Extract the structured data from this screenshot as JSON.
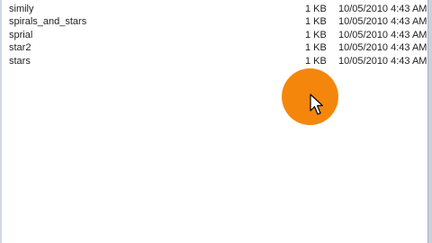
{
  "window": {
    "accent_border": "#cfd8e3",
    "highlight_color": "#f5860c"
  },
  "files": [
    {
      "name": "",
      "size": "",
      "modified": ""
    },
    {
      "name": "simily",
      "size": "1 KB",
      "modified": "10/05/2010 4:43 AM"
    },
    {
      "name": "spirals_and_stars",
      "size": "1 KB",
      "modified": "10/05/2010 4:43 AM"
    },
    {
      "name": "sprial",
      "size": "1 KB",
      "modified": "10/05/2010 4:43 AM"
    },
    {
      "name": "star2",
      "size": "1 KB",
      "modified": "10/05/2010 4:43 AM"
    },
    {
      "name": "stars",
      "size": "1 KB",
      "modified": "10/05/2010 4:43 AM"
    }
  ],
  "cursor": {
    "icon": "mouse-pointer-icon",
    "highlight": "click-highlight"
  }
}
